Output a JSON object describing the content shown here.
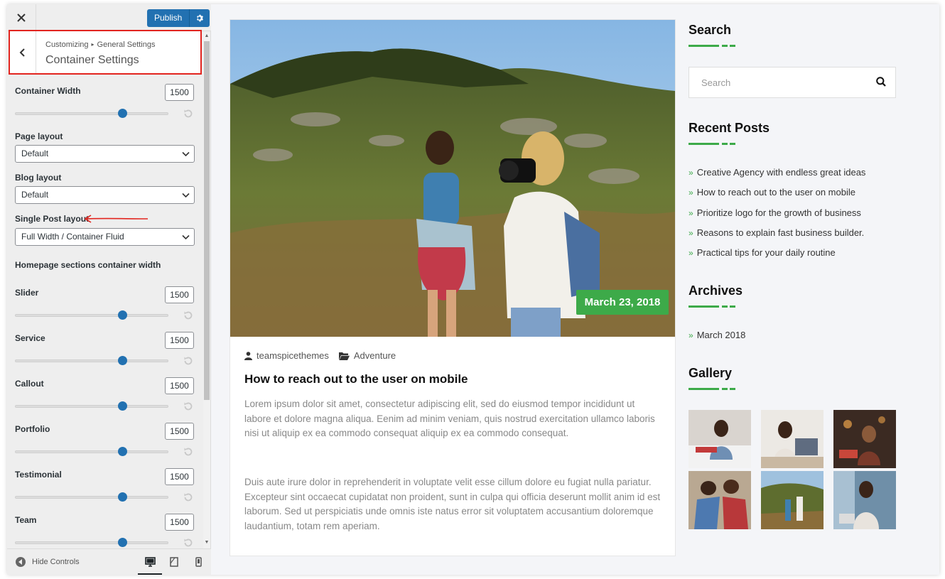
{
  "topbar": {
    "publish_label": "Publish"
  },
  "panel": {
    "breadcrumb_root": "Customizing",
    "breadcrumb_section": "General Settings",
    "title": "Container Settings"
  },
  "controls": {
    "container_width": {
      "label": "Container Width",
      "value": "1500",
      "level": 0.7
    },
    "page_layout": {
      "label": "Page layout",
      "selected": "Default"
    },
    "blog_layout": {
      "label": "Blog layout",
      "selected": "Default"
    },
    "single_post_layout": {
      "label": "Single Post layout",
      "selected": "Full Width / Container Fluid"
    },
    "homepage_heading": "Homepage sections container width",
    "sections": [
      {
        "label": "Slider",
        "value": "1500",
        "level": 0.7
      },
      {
        "label": "Service",
        "value": "1500",
        "level": 0.7
      },
      {
        "label": "Callout",
        "value": "1500",
        "level": 0.7
      },
      {
        "label": "Portfolio",
        "value": "1500",
        "level": 0.7
      },
      {
        "label": "Testimonial",
        "value": "1500",
        "level": 0.7
      },
      {
        "label": "Team",
        "value": "1500",
        "level": 0.7
      }
    ]
  },
  "footer": {
    "hide_controls": "Hide Controls"
  },
  "post": {
    "date": "March 23, 2018",
    "author": "teamspicethemes",
    "category": "Adventure",
    "title": "How to reach out to the user on mobile",
    "paragraph1": "Lorem ipsum dolor sit amet, consectetur adipiscing elit, sed do eiusmod tempor incididunt ut labore et dolore magna aliqua. Eenim ad minim veniam, quis nostrud exercitation ullamco laboris nisi ut aliquip ex ea commodo consequat aliquip ex ea commodo consequat.",
    "paragraph2": "Duis aute irure dolor in reprehenderit in voluptate velit esse cillum dolore eu fugiat nulla pariatur. Excepteur sint occaecat cupidatat non proident, sunt in culpa qui officia deserunt mollit anim id est laborum. Sed ut perspiciatis unde omnis iste natus error sit voluptatem accusantium doloremque laudantium, totam rem aperiam."
  },
  "widgets": {
    "search": {
      "title": "Search",
      "placeholder": "Search"
    },
    "recent_posts": {
      "title": "Recent Posts",
      "items": [
        "Creative Agency with endless great ideas",
        "How to reach out to the user on mobile",
        "Prioritize logo for the growth of business",
        "Reasons to explain fast business builder.",
        "Practical tips for your daily routine"
      ]
    },
    "archives": {
      "title": "Archives",
      "items": [
        "March 2018"
      ]
    },
    "gallery": {
      "title": "Gallery"
    }
  },
  "colors": {
    "accent": "#3daa49",
    "wp_blue": "#2271b1",
    "highlight_red": "#e2251f"
  }
}
